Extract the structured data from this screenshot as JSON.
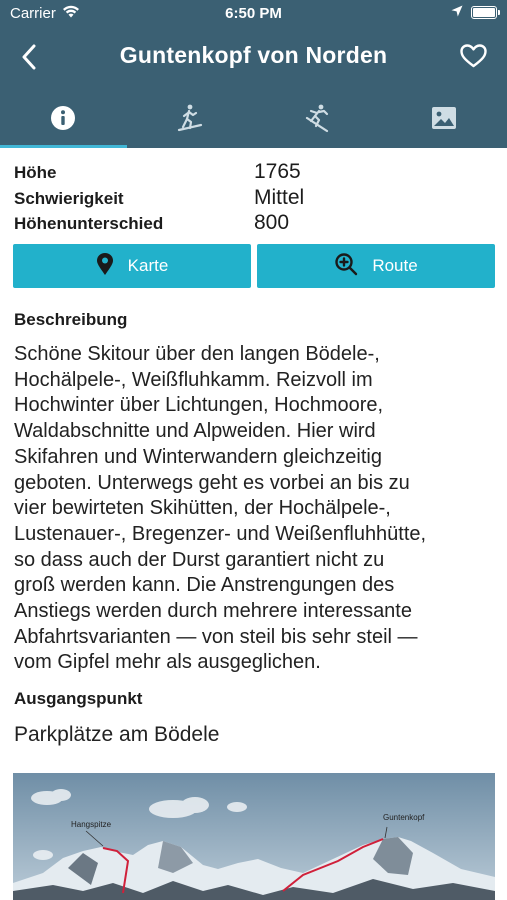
{
  "status": {
    "carrier": "Carrier",
    "time": "6:50 PM"
  },
  "header": {
    "title": "Guntenkopf von Norden"
  },
  "tabs": [
    {
      "icon": "info-icon",
      "active": true
    },
    {
      "icon": "ski-ascent-icon",
      "active": false
    },
    {
      "icon": "skier-descent-icon",
      "active": false
    },
    {
      "icon": "image-icon",
      "active": false
    }
  ],
  "facts": [
    {
      "label": "Höhe",
      "value": "1765"
    },
    {
      "label": "Schwierigkeit",
      "value": "Mittel"
    },
    {
      "label": "Höhenunterschied",
      "value": "800"
    }
  ],
  "buttons": {
    "map_label": "Karte",
    "route_label": "Route"
  },
  "description": {
    "heading": "Beschreibung",
    "lines": [
      "Schöne Skitour über den langen Bödele-,",
      "Hochälpele-, Weißfluhkamm. Reizvoll im",
      "Hochwinter über Lichtungen, Hochmoore,",
      "Waldabschnitte und Alpweiden. Hier wird",
      "Skifahren und Winterwandern gleichzeitig",
      "geboten. Unterwegs geht es vorbei an bis zu",
      "vier bewirteten Skihütten, der Hochälpele-,",
      "Lustenauer-, Bregenzer- und Weißenfluhhütte,",
      "so dass auch der Durst garantiert nicht zu",
      "groß werden kann. Die Anstrengungen des",
      "Anstiegs werden durch mehrere interessante",
      "Abfahrtsvarianten — von steil bis sehr steil —",
      "vom Gipfel mehr als ausgeglichen."
    ]
  },
  "start": {
    "heading": "Ausgangspunkt",
    "text": "Parkplätze am Bödele"
  },
  "photo": {
    "labels": [
      "Hangspitze",
      "Guntenkopf"
    ]
  },
  "colors": {
    "header_bg": "#3b6073",
    "accent": "#22b1cb",
    "tab_indicator": "#41b7d6",
    "route_line": "#d0203a"
  }
}
